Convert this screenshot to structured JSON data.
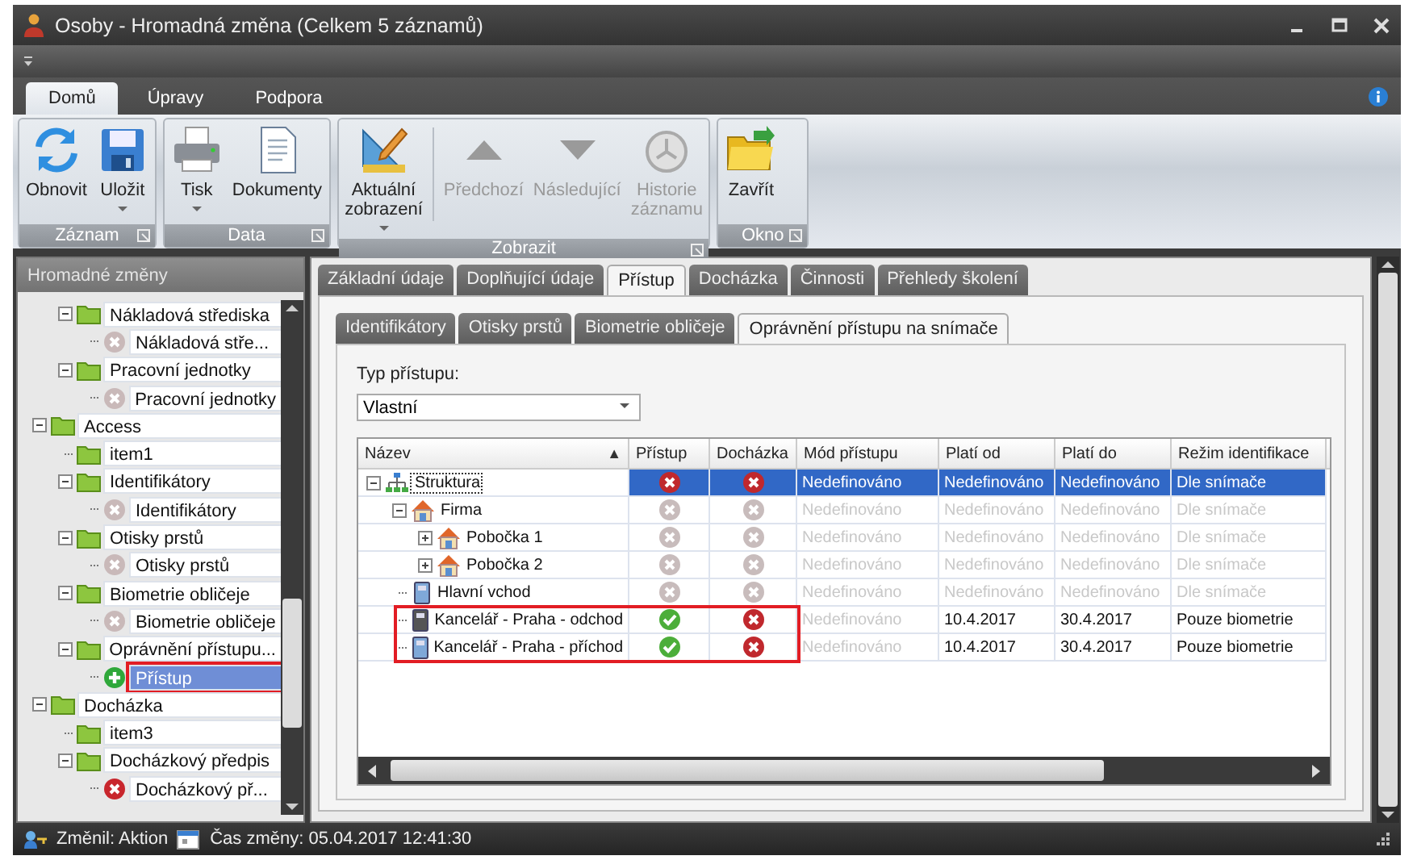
{
  "window": {
    "title": "Osoby - Hromadná změna (Celkem 5 záznamů)"
  },
  "ribbon": {
    "tabs": [
      {
        "label": "Domů",
        "selected": true
      },
      {
        "label": "Úpravy",
        "selected": false
      },
      {
        "label": "Podpora",
        "selected": false
      }
    ],
    "groups": [
      {
        "label": "Záznam",
        "buttons": [
          {
            "label": "Obnovit",
            "dropdown": false,
            "disabled": false
          },
          {
            "label": "Uložit",
            "dropdown": true,
            "disabled": false
          }
        ]
      },
      {
        "label": "Data",
        "buttons": [
          {
            "label": "Tisk",
            "dropdown": true,
            "disabled": false
          },
          {
            "label": "Dokumenty",
            "dropdown": false,
            "disabled": false
          }
        ]
      },
      {
        "label": "Zobrazit",
        "buttons": [
          {
            "label": "Aktuální zobrazení",
            "dropdown": true,
            "disabled": false
          },
          {
            "label": "Předchozí",
            "dropdown": false,
            "disabled": true
          },
          {
            "label": "Následující",
            "dropdown": false,
            "disabled": true
          },
          {
            "label": "Historie záznamu",
            "dropdown": false,
            "disabled": true
          }
        ]
      },
      {
        "label": "Okno",
        "buttons": [
          {
            "label": "Zavřít",
            "dropdown": false,
            "disabled": false
          }
        ]
      }
    ]
  },
  "sidebar": {
    "title": "Hromadné změny",
    "tree": [
      {
        "children": [
          {
            "label": "Nákladová střediska",
            "kind": "folder",
            "selected": false,
            "highlighted": false,
            "children": [
              {
                "label": "Nákladová stře...",
                "kind": "remove",
                "disabled": true,
                "selected": false,
                "highlighted": false
              }
            ]
          },
          {
            "label": "Pracovní jednotky",
            "kind": "folder",
            "selected": false,
            "highlighted": false,
            "children": [
              {
                "label": "Pracovní jednotky",
                "kind": "remove",
                "disabled": true,
                "selected": false,
                "highlighted": false
              }
            ]
          }
        ]
      },
      {
        "label": "Access",
        "kind": "folder",
        "selected": false,
        "highlighted": false,
        "children": [
          {
            "label": "item1",
            "kind": "folder",
            "selected": false,
            "highlighted": false
          },
          {
            "label": "Identifikátory",
            "kind": "folder",
            "selected": false,
            "highlighted": false,
            "children": [
              {
                "label": "Identifikátory",
                "kind": "remove",
                "disabled": true,
                "selected": false,
                "highlighted": false
              }
            ]
          },
          {
            "label": "Otisky prstů",
            "kind": "folder",
            "selected": false,
            "highlighted": false,
            "children": [
              {
                "label": "Otisky prstů",
                "kind": "remove",
                "disabled": true,
                "selected": false,
                "highlighted": false
              }
            ]
          },
          {
            "label": "Biometrie obličeje",
            "kind": "folder",
            "selected": false,
            "highlighted": false,
            "children": [
              {
                "label": "Biometrie obličeje",
                "kind": "remove",
                "disabled": true,
                "selected": false,
                "highlighted": false
              }
            ]
          },
          {
            "label": "Oprávnění přístupu...",
            "kind": "folder",
            "selected": false,
            "highlighted": false,
            "children": [
              {
                "label": "Přístup",
                "kind": "add",
                "disabled": false,
                "selected": true,
                "highlighted": true
              }
            ]
          }
        ]
      },
      {
        "label": "Docházka",
        "kind": "folder",
        "selected": false,
        "highlighted": false,
        "children": [
          {
            "label": "item3",
            "kind": "folder",
            "selected": false,
            "highlighted": false
          },
          {
            "label": "Docházkový předpis",
            "kind": "folder",
            "selected": false,
            "highlighted": false,
            "children": [
              {
                "label": "Docházkový př...",
                "kind": "remove",
                "disabled": false,
                "selected": false,
                "highlighted": false
              }
            ]
          }
        ]
      }
    ]
  },
  "tabs": [
    {
      "label": "Základní údaje",
      "selected": false
    },
    {
      "label": "Doplňující údaje",
      "selected": false
    },
    {
      "label": "Přístup",
      "selected": true
    },
    {
      "label": "Docházka",
      "selected": false
    },
    {
      "label": "Činnosti",
      "selected": false
    },
    {
      "label": "Přehledy školení",
      "selected": false
    }
  ],
  "subtabs": [
    {
      "label": "Identifikátory",
      "selected": false
    },
    {
      "label": "Otisky prstů",
      "selected": false
    },
    {
      "label": "Biometrie obličeje",
      "selected": false
    },
    {
      "label": "Oprávnění přístupu na snímače",
      "selected": true
    }
  ],
  "access_type": {
    "label": "Typ přístupu:",
    "value": "Vlastní"
  },
  "grid": {
    "columns": [
      {
        "label": "Název",
        "sort_arrow": "▲"
      },
      {
        "label": "Přístup"
      },
      {
        "label": "Docházka"
      },
      {
        "label": "Mód přístupu"
      },
      {
        "label": "Platí od"
      },
      {
        "label": "Platí do"
      },
      {
        "label": "Režim identifikace"
      }
    ],
    "rows": [
      {
        "name": "Struktura",
        "kind": "structure",
        "expanded": true,
        "access": false,
        "attendance": false,
        "mode": "Nedefinováno",
        "valid_from": "Nedefinováno",
        "valid_to": "Nedefinováno",
        "id_mode": "Dle snímače",
        "selected": true,
        "disabled": false,
        "highlighted": false,
        "children": [
          {
            "name": "Firma",
            "kind": "company",
            "expanded": true,
            "access": false,
            "attendance": false,
            "mode": "Nedefinováno",
            "valid_from": "Nedefinováno",
            "valid_to": "Nedefinováno",
            "id_mode": "Dle snímače",
            "selected": false,
            "disabled": true,
            "highlighted": false,
            "children": [
              {
                "name": "Pobočka 1",
                "kind": "branch",
                "expanded": false,
                "access": false,
                "attendance": false,
                "mode": "Nedefinováno",
                "valid_from": "Nedefinováno",
                "valid_to": "Nedefinováno",
                "id_mode": "Dle snímače",
                "selected": false,
                "disabled": true,
                "highlighted": false
              },
              {
                "name": "Pobočka 2",
                "kind": "branch",
                "expanded": false,
                "access": false,
                "attendance": false,
                "mode": "Nedefinováno",
                "valid_from": "Nedefinováno",
                "valid_to": "Nedefinováno",
                "id_mode": "Dle snímače",
                "selected": false,
                "disabled": true,
                "highlighted": false
              }
            ]
          },
          {
            "name": "Hlavní vchod",
            "kind": "reader",
            "access": false,
            "attendance": false,
            "mode": "Nedefinováno",
            "valid_from": "Nedefinováno",
            "valid_to": "Nedefinováno",
            "id_mode": "Dle snímače",
            "selected": false,
            "disabled": true,
            "highlighted": false
          },
          {
            "name": "Kancelář - Praha - odchod",
            "kind": "reader_dark",
            "access": true,
            "attendance": false,
            "mode": "Nedefinováno",
            "valid_from": "10.4.2017",
            "valid_to": "30.4.2017",
            "id_mode": "Pouze biometrie",
            "selected": false,
            "disabled": false,
            "highlighted": true
          },
          {
            "name": "Kancelář - Praha - příchod",
            "kind": "reader",
            "access": true,
            "attendance": false,
            "mode": "Nedefinováno",
            "valid_from": "10.4.2017",
            "valid_to": "30.4.2017",
            "id_mode": "Pouze biometrie",
            "selected": false,
            "disabled": false,
            "highlighted": true
          }
        ]
      }
    ]
  },
  "status_bar": {
    "changed_by": "Změnil: Aktion",
    "changed_at": "Čas změny: 05.04.2017 12:41:30"
  }
}
